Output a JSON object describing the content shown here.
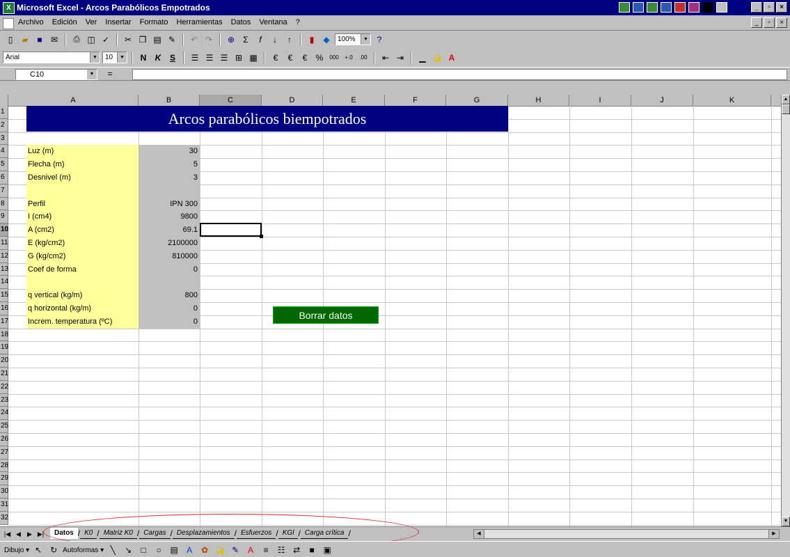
{
  "window": {
    "title": "Microsoft Excel - Arcos Parabólicos Empotrados",
    "app_icon": "excel-icon",
    "buttons": [
      "minimize",
      "restore",
      "close"
    ]
  },
  "menu": {
    "items": [
      "Archivo",
      "Edición",
      "Ver",
      "Insertar",
      "Formato",
      "Herramientas",
      "Datos",
      "Ventana",
      "?"
    ]
  },
  "toolbar_standard": {
    "icons": [
      "new-icon",
      "open-icon",
      "save-icon",
      "email-icon",
      "print-icon",
      "print-preview-icon",
      "spelling-icon",
      "cut-icon",
      "copy-icon",
      "paste-icon",
      "format-painter-icon",
      "undo-icon",
      "redo-icon",
      "hyperlink-icon",
      "autosum-icon",
      "function-icon",
      "sort-asc-icon",
      "sort-desc-icon",
      "chart-wizard-icon",
      "drawing-icon",
      "help-icon"
    ],
    "zoom": "100%"
  },
  "toolbar_format": {
    "font": "Arial",
    "size": "10",
    "buttons": [
      "N",
      "K",
      "S"
    ]
  },
  "formula_bar": {
    "name_box": "C10",
    "equals": "=",
    "content": ""
  },
  "columns": [
    "A",
    "B",
    "C",
    "D",
    "E",
    "F",
    "G",
    "H",
    "I",
    "J",
    "K"
  ],
  "rows": [
    "1",
    "2",
    "3",
    "4",
    "5",
    "6",
    "7",
    "8",
    "9",
    "10",
    "11",
    "12",
    "13",
    "14",
    "15",
    "16",
    "17",
    "18",
    "19",
    "20",
    "21",
    "22",
    "23",
    "24",
    "25",
    "26",
    "27",
    "28",
    "29",
    "30",
    "31",
    "32"
  ],
  "sheet": {
    "banner": "Arcos parabólicos biempotrados",
    "params": [
      {
        "row": 4,
        "label": "Luz (m)",
        "value": "30"
      },
      {
        "row": 5,
        "label": "Flecha (m)",
        "value": "5"
      },
      {
        "row": 6,
        "label": "Desnivel (m)",
        "value": "3"
      },
      {
        "row": 8,
        "label": "Perfil",
        "value": "IPN 300"
      },
      {
        "row": 9,
        "label": "I (cm4)",
        "value": "9800"
      },
      {
        "row": 10,
        "label": "A (cm2)",
        "value": "69.1"
      },
      {
        "row": 11,
        "label": "E (kg/cm2)",
        "value": "2100000"
      },
      {
        "row": 12,
        "label": "G (kg/cm2)",
        "value": "810000"
      },
      {
        "row": 13,
        "label": "Coef de forma",
        "value": "0"
      },
      {
        "row": 15,
        "label": "q vertical (kg/m)",
        "value": "800"
      },
      {
        "row": 16,
        "label": "q horizontal (kg/m)",
        "value": "0"
      },
      {
        "row": 17,
        "label": "Increm. temperatura (ºC)",
        "value": "0"
      }
    ],
    "button_label": "Borrar datos",
    "active_cell": "C10"
  },
  "tabs": [
    "Datos",
    "K0",
    "Matriz K0",
    "Cargas",
    "Desplazamientos",
    "Esfuerzos",
    "KGl",
    "Carga crítica"
  ],
  "active_tab": "Datos",
  "draw_toolbar": {
    "draw_label": "Dibujo",
    "autoshapes_label": "Autoformas"
  },
  "colors": {
    "title_bar": "#000080",
    "banner_bg": "#000080",
    "label_bg": "#ffff99",
    "value_bg": "#c0c0c0",
    "button_bg": "#006600",
    "annotation": "#e02020"
  }
}
